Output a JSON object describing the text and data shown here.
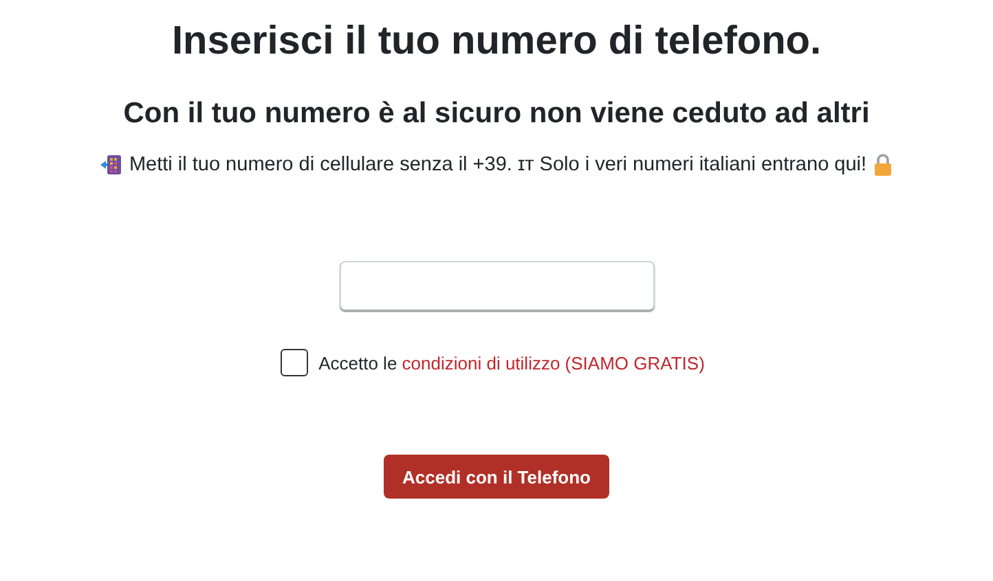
{
  "title": "Inserisci il tuo numero di telefono.",
  "subtitle": "Con il tuo numero è al sicuro non viene ceduto ad altri",
  "instruction": "Metti il tuo numero di cellulare senza il +39. ɪᴛ Solo i veri numeri italiani entrano qui!",
  "terms": {
    "checked": false,
    "label": "Accetto le",
    "link": "condizioni di utilizzo (SIAMO GRATIS)"
  },
  "submit_button": "Accedi con il Telefono"
}
